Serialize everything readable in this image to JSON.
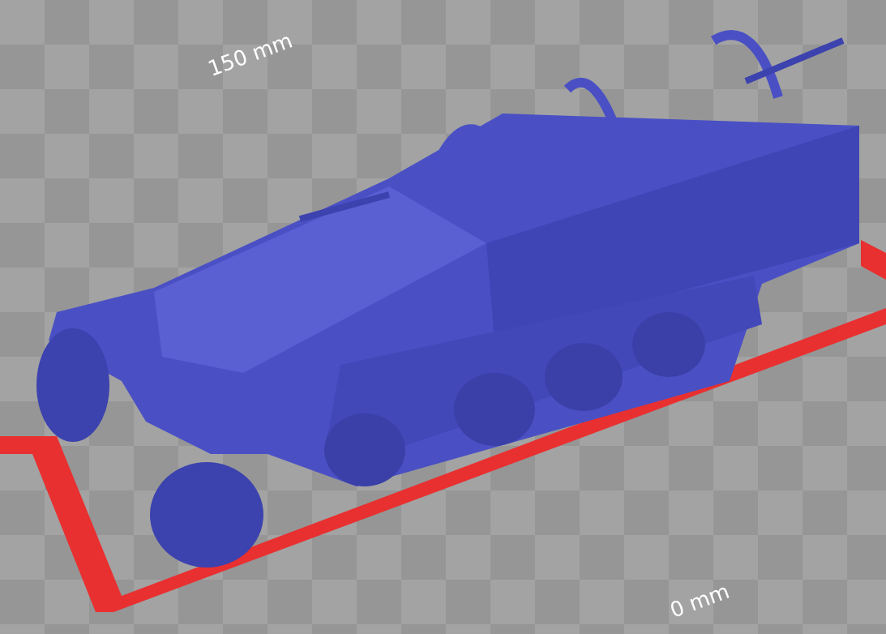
{
  "viewport": {
    "far_edge_label": "150 mm",
    "near_edge_label": "0 mm"
  }
}
